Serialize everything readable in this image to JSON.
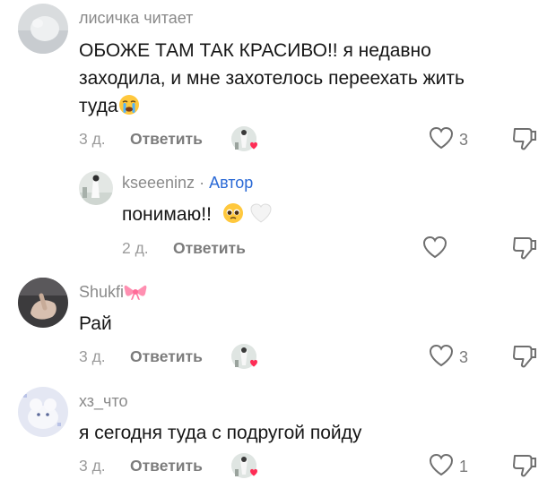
{
  "comments": [
    {
      "username": "лисичка читает",
      "text_lines": [
        "ОБОЖЕ ТАМ ТАК КРАСИВО!! я недавно",
        "заходила, и мне захотелось переехать жить",
        "туда"
      ],
      "emoji_end": "loudly-crying-face",
      "time": "3 д.",
      "reply_label": "Ответить",
      "likes": "3",
      "creator_liked": true
    },
    {
      "username": "kseeeninz",
      "separator": " · ",
      "badge": "Автор",
      "text": "понимаю!!",
      "emojis": [
        "pleading-face",
        "white-heart"
      ],
      "time": "2 д.",
      "reply_label": "Ответить",
      "likes": ""
    },
    {
      "username": "Shukfi",
      "username_emoji": "ribbon",
      "text": "Рай",
      "time": "3 д.",
      "reply_label": "Ответить",
      "likes": "3",
      "creator_liked": true
    },
    {
      "username": "хз_что",
      "text": "я сегодня туда с подругой пойду",
      "time": "3 д.",
      "reply_label": "Ответить",
      "likes": "1",
      "creator_liked": true
    }
  ],
  "colors": {
    "author_badge": "#2b6ad6",
    "liked_heart": "#fe2c55",
    "muted_text": "#8a8a8a"
  }
}
